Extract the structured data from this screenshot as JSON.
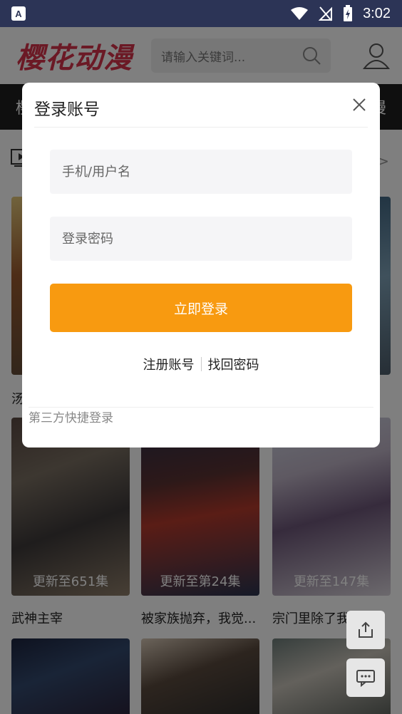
{
  "status_bar": {
    "app_icon_letter": "A",
    "time": "3:02"
  },
  "header": {
    "logo": "樱花动漫",
    "search_placeholder": "请输入关键词..."
  },
  "nav": {
    "left_text": "樱",
    "right_text": "动漫"
  },
  "cards": [
    {
      "title": "汤",
      "episode": ""
    },
    {
      "title": "",
      "episode": ""
    },
    {
      "title": "",
      "episode": ""
    },
    {
      "title": "武神主宰",
      "episode": "更新至651集"
    },
    {
      "title": "被家族抛弃，我觉...",
      "episode": "更新至第24集"
    },
    {
      "title": "宗门里除了我...",
      "episode": "更新至147集"
    }
  ],
  "modal": {
    "title": "登录账号",
    "username_placeholder": "手机/用户名",
    "password_placeholder": "登录密码",
    "login_button": "立即登录",
    "register_link": "注册账号",
    "forgot_link": "找回密码",
    "third_party_label": "第三方快捷登录"
  },
  "colors": {
    "accent": "#f89a10",
    "logo": "#d6334a",
    "status_bar": "#2c3456"
  }
}
